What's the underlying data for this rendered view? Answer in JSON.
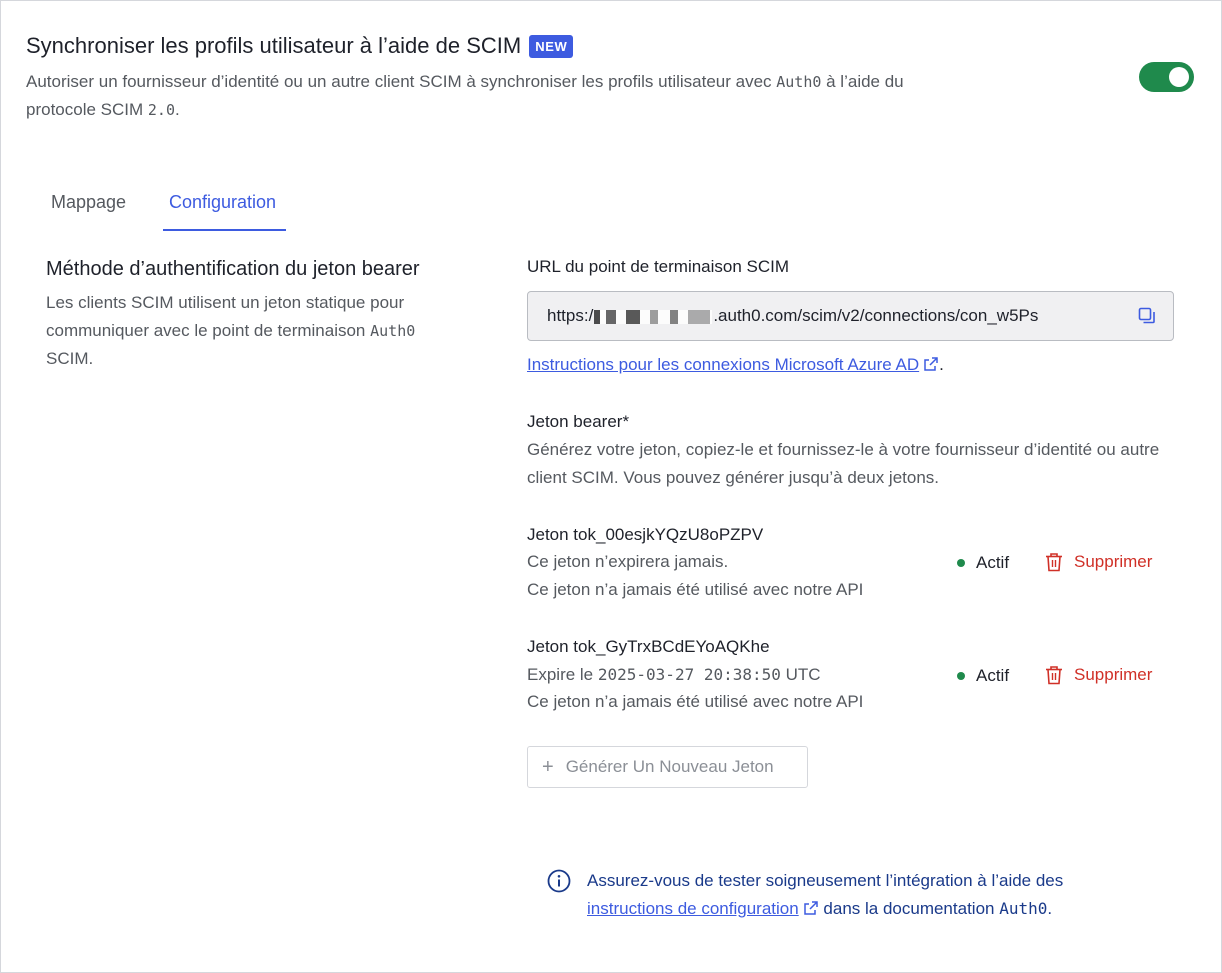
{
  "header": {
    "title": "Synchroniser les profils utilisateur à l’aide de SCIM",
    "badge": "NEW",
    "description_line1": "Autoriser un fournisseur d’identité ou un autre client SCIM à synchroniser les profils utilisateur avec ",
    "description_brand": "Auth0",
    "description_line1_end": " à l’aide du",
    "description_line2": "protocole SCIM ",
    "description_version": "2.0",
    "description_end": ".",
    "toggle_on": true,
    "toggle_color": "#1f8a4c"
  },
  "tabs": [
    {
      "label": "Mappage",
      "active": false
    },
    {
      "label": "Configuration",
      "active": true
    }
  ],
  "auth_method": {
    "title": "Méthode d’authentification du jeton bearer",
    "description_prefix": "Les clients SCIM utilisent un jeton statique pour communiquer avec le point de terminaison ",
    "description_brand": "Auth0",
    "description_suffix": " SCIM."
  },
  "endpoint": {
    "label": "URL du point de terminaison SCIM",
    "url_prefix": "https:/",
    "url_suffix": ".auth0.com/scim/v2/connections/con_w5Ps",
    "copy_icon": "copy-icon"
  },
  "azure_link": {
    "text": "Instructions pour les connexions Microsoft Azure AD",
    "suffix": "."
  },
  "bearer": {
    "label": "Jeton bearer*",
    "description": "Générez votre jeton, copiez-le et fournissez-le à votre fournisseur d’identité ou autre client SCIM. Vous pouvez générer jusqu’à deux jetons."
  },
  "tokens": [
    {
      "title": "Jeton tok_00esjkYQzU8oPZPV",
      "expiry": "Ce jeton n’expirera jamais.",
      "expiry_date": "",
      "expiry_suffix": "",
      "usage": "Ce jeton n’a jamais été utilisé avec notre API",
      "status": "Actif",
      "delete_label": "Supprimer"
    },
    {
      "title": "Jeton tok_GyTrxBCdEYoAQKhe",
      "expiry": "Expire le ",
      "expiry_date": "2025-03-27 20:38:50",
      "expiry_suffix": " UTC",
      "usage": "Ce jeton n’a jamais été utilisé avec notre API",
      "status": "Actif",
      "delete_label": "Supprimer"
    }
  ],
  "generate_button": {
    "label": "Générer Un Nouveau Jeton"
  },
  "info": {
    "text_before": "Assurez-vous de tester soigneusement l’intégration à l’aide des ",
    "link_text": "instructions de configuration",
    "text_after": " dans la documentation ",
    "brand": "Auth0",
    "end": "."
  },
  "colors": {
    "accent": "#3d5be0",
    "success": "#1f8a4c",
    "danger": "#d03027"
  }
}
